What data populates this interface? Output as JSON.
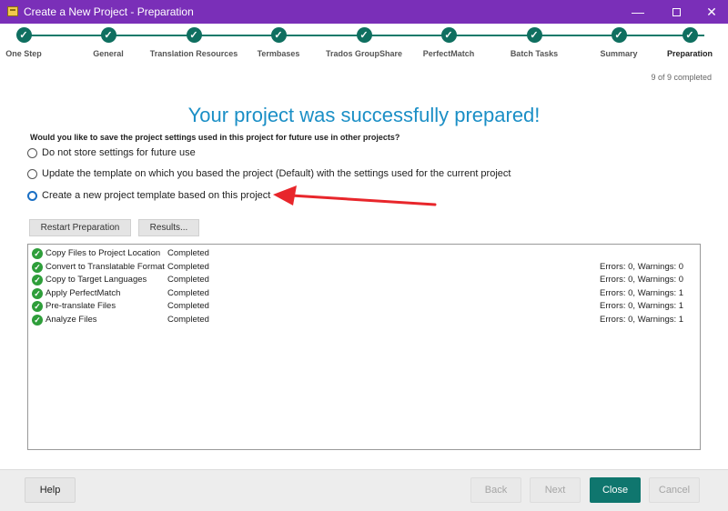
{
  "window": {
    "title": "Create a New Project - Preparation",
    "controls": {
      "minimize": "—",
      "close": "✕"
    }
  },
  "steps": [
    {
      "label": "One Step",
      "check": "✓"
    },
    {
      "label": "General",
      "check": "✓"
    },
    {
      "label": "Translation Resources",
      "check": "✓"
    },
    {
      "label": "Termbases",
      "check": "✓"
    },
    {
      "label": "Trados GroupShare",
      "check": "✓"
    },
    {
      "label": "PerfectMatch",
      "check": "✓"
    },
    {
      "label": "Batch Tasks",
      "check": "✓"
    },
    {
      "label": "Summary",
      "check": "✓"
    },
    {
      "label": "Preparation",
      "check": "✓"
    }
  ],
  "progress": {
    "completed_text": "9 of 9 completed",
    "done": 9,
    "total": 9
  },
  "main": {
    "headline": "Your project was successfully prepared!",
    "question": "Would you like to save the project settings used in this project for future use in other projects?",
    "options": [
      {
        "label": "Do not store settings for future use",
        "selected": false
      },
      {
        "label": "Update the template on which you based the project (Default) with the settings used for the current project",
        "selected": false
      },
      {
        "label": "Create a new project template based on this project",
        "selected": false
      }
    ],
    "restart_button": "Restart Preparation",
    "results_button": "Results...",
    "annotation_arrow_color": "#e8262b"
  },
  "results": [
    {
      "name": "Copy Files to Project Location",
      "status": "Completed",
      "errors": ""
    },
    {
      "name": "Convert to Translatable Format",
      "status": "Completed",
      "errors": "Errors: 0, Warnings: 0"
    },
    {
      "name": "Copy to Target Languages",
      "status": "Completed",
      "errors": "Errors: 0, Warnings: 0"
    },
    {
      "name": "Apply PerfectMatch",
      "status": "Completed",
      "errors": "Errors: 0, Warnings: 1"
    },
    {
      "name": "Pre-translate Files",
      "status": "Completed",
      "errors": "Errors: 0, Warnings: 1"
    },
    {
      "name": "Analyze Files",
      "status": "Completed",
      "errors": "Errors: 0, Warnings: 1"
    }
  ],
  "footer": {
    "help": "Help",
    "back": "Back",
    "next": "Next",
    "close": "Close",
    "cancel": "Cancel"
  },
  "colors": {
    "titlebar": "#7a2fb8",
    "step_accent": "#0f6f60",
    "headline": "#1b8fc6",
    "success": "#2e9e3a",
    "primary_button": "#0f766e"
  }
}
